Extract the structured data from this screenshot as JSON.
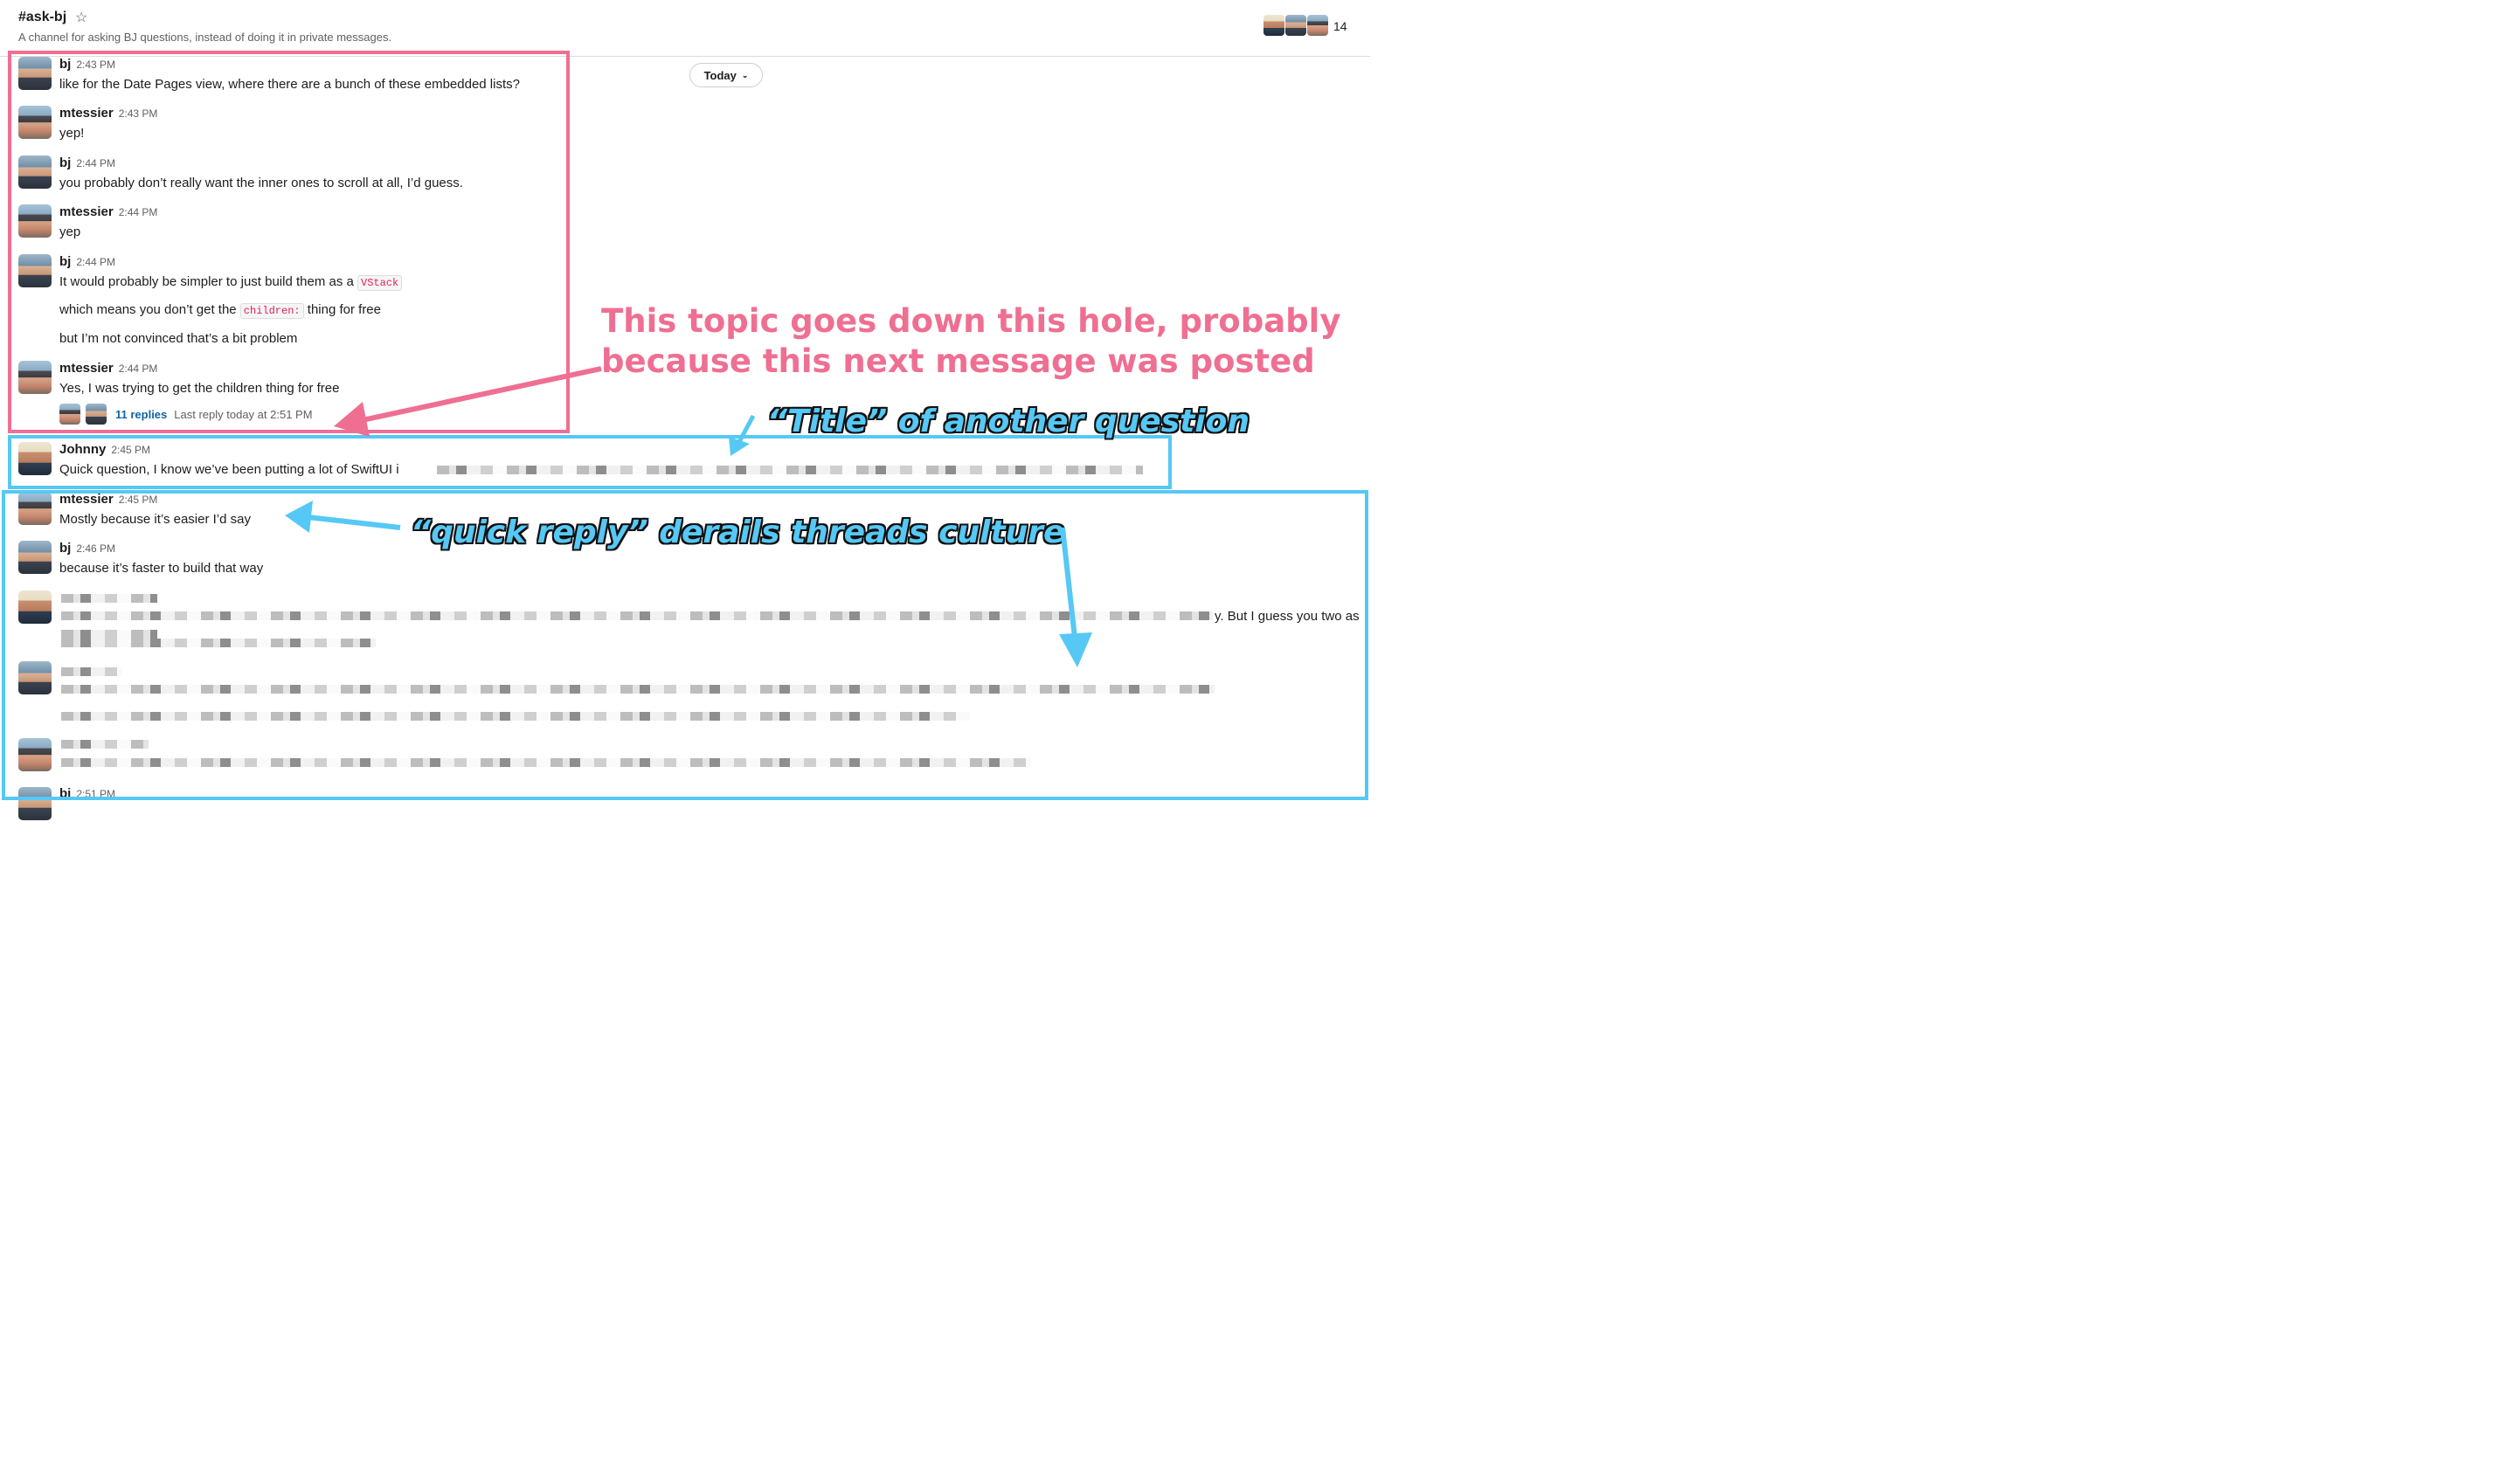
{
  "header": {
    "channel_title": "#ask-bj",
    "description": "A channel for asking BJ questions, instead of doing it in private messages.",
    "member_count": "14",
    "star_icon": "star-icon"
  },
  "date_divider": {
    "label": "Today"
  },
  "messages": [
    {
      "sender": "bj",
      "time": "2:43 PM",
      "lines": [
        "like for the Date Pages view, where there are a bunch of these embedded lists?"
      ]
    },
    {
      "sender": "mtessier",
      "time": "2:43 PM",
      "lines": [
        "yep!"
      ]
    },
    {
      "sender": "bj",
      "time": "2:44 PM",
      "lines": [
        "you probably don’t really want the inner ones to scroll at all, I’d guess."
      ]
    },
    {
      "sender": "mtessier",
      "time": "2:44 PM",
      "lines": [
        "yep"
      ]
    },
    {
      "sender": "bj",
      "time": "2:44 PM",
      "line1_text": "It would probably be simpler to just build them as a",
      "line1_code": "VStack",
      "line2_pre": "which means you don’t get the",
      "line2_code": "children:",
      "line2_post": "thing for free",
      "line3": "but I’m not convinced that’s a bit problem"
    },
    {
      "sender": "mtessier",
      "time": "2:44 PM",
      "lines": [
        "Yes, I was trying to get the children thing for free"
      ],
      "replies": "11 replies",
      "last_reply": "Last reply today at 2:51 PM"
    },
    {
      "sender": "Johnny",
      "time": "2:45 PM",
      "lines": [
        "Quick question, I know we’ve been putting a lot of SwiftUI i"
      ]
    },
    {
      "sender": "mtessier",
      "time": "2:45 PM",
      "lines": [
        "Mostly because it’s easier I’d say"
      ]
    },
    {
      "sender": "bj",
      "time": "2:46 PM",
      "lines": [
        "because it’s faster to build that way"
      ]
    },
    {
      "visible_fragment": "y. But I guess you two as"
    },
    {
      "sender": "bj",
      "time": "2:51 PM"
    }
  ],
  "annotations": {
    "pink_line1": "This topic goes down this hole, probably",
    "pink_line2": "because this next message was posted",
    "blue_title": "“Title” of another question",
    "blue_quick": "“quick reply” derails threads culture"
  },
  "colors": {
    "pink": "#ef6f92",
    "blue": "#56c8f5",
    "link": "#1264a3"
  }
}
